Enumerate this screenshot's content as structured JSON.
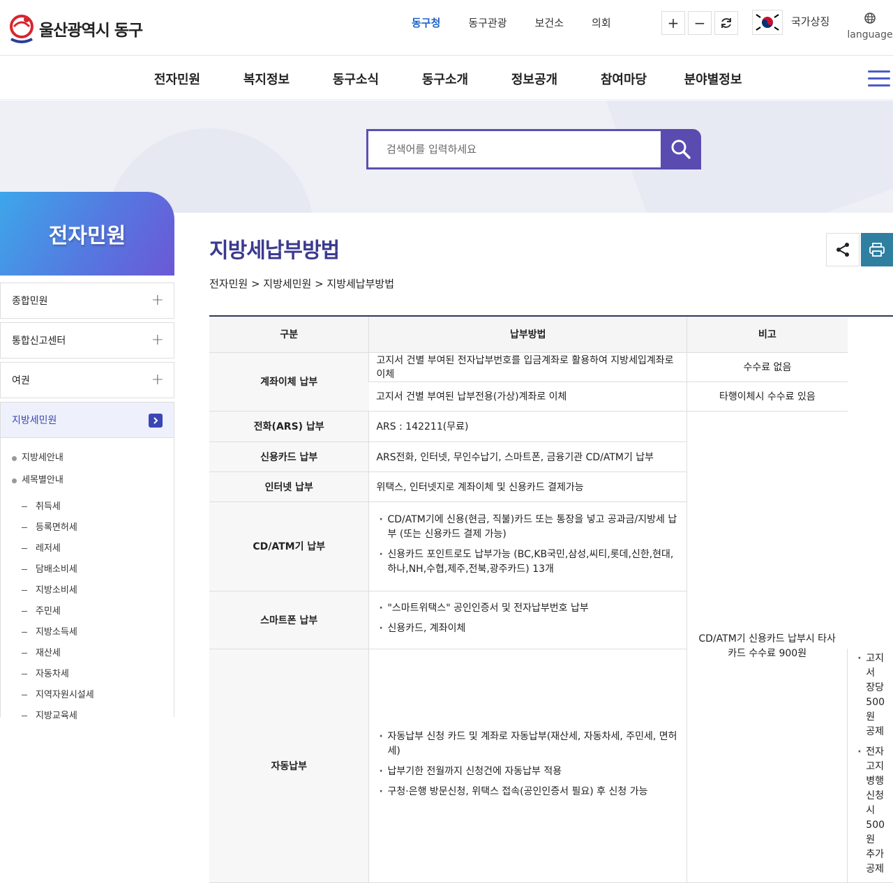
{
  "header": {
    "logo_text": "울산광역시 동구",
    "top_nav": [
      {
        "label": "동구청",
        "active": true
      },
      {
        "label": "동구관광",
        "active": false
      },
      {
        "label": "보건소",
        "active": false
      },
      {
        "label": "의회",
        "active": false
      }
    ],
    "national_symbol_label": "국가상징",
    "language_label": "language"
  },
  "main_nav": [
    "전자민원",
    "복지정보",
    "동구소식",
    "동구소개",
    "정보공개",
    "참여마당",
    "분야별정보"
  ],
  "search": {
    "placeholder": "검색어를 입력하세요"
  },
  "sidebar": {
    "title": "전자민원",
    "items": [
      "종합민원",
      "통합신고센터",
      "여권",
      "지방세민원"
    ],
    "subitems": [
      "지방세안내",
      "세목별안내"
    ],
    "subsubitems": [
      "취득세",
      "등록면허세",
      "레저세",
      "담배소비세",
      "지방소비세",
      "주민세",
      "지방소득세",
      "재산세",
      "자동차세",
      "지역자원시설세",
      "지방교육세"
    ]
  },
  "content": {
    "title": "지방세납부방법",
    "breadcrumb": "전자민원 > 지방세민원 > 지방세납부방법"
  },
  "table": {
    "headers": [
      "구분",
      "납부방법",
      "비고"
    ],
    "rows": {
      "account": {
        "category": "계좌이체 납부",
        "method1": "고지서 건별 부여된 전자납부번호를 입금계좌로 활용하여 지방세입계좌로 이체",
        "note1": "수수료 없음",
        "method2": "고지서 건별 부여된 납부전용(가상)계좌로 이체",
        "note2": "타행이체시 수수료 있음"
      },
      "ars": {
        "category": "전화(ARS) 납부",
        "method": "ARS : 142211(무료)"
      },
      "card": {
        "category": "신용카드 납부",
        "method": "ARS전화, 인터넷, 무인수납기, 스마트폰, 금융기관 CD/ATM기 납부"
      },
      "internet": {
        "category": "인터넷 납부",
        "method": "위택스, 인터넷지로 계좌이체 및 신용카드 결제가능"
      },
      "atm": {
        "category": "CD/ATM기 납부",
        "bullets": [
          "CD/ATM기에 신용(현금, 직불)카드 또는 통장을 넣고 공과금/지방세 납부 (또는 신용카드 결제 가능)",
          "신용카드 포인트로도 납부가능 (BC,KB국민,삼성,씨티,롯데,신한,현대, 하나,NH,수협,제주,전북,광주카드) 13개"
        ]
      },
      "shared_note": "CD/ATM기 신용카드 납부시 타사카드 수수료 900원",
      "smartphone": {
        "category": "스마트폰 납부",
        "bullets": [
          "\"스마트위택스\" 공인인증서 및 전자납부번호 납부",
          "신용카드, 계좌이체"
        ]
      },
      "auto": {
        "category": "자동납부",
        "bullets": [
          "자동납부 신청 카드 및 계좌로 자동납부(재산세, 자동차세, 주민세, 면허세)",
          "납부기한 전월까지 신청건에 자동납부 적용",
          "구청·은행 방문신청, 위택스 접속(공인인증서 필요) 후 신청 가능"
        ],
        "notes": [
          "고지서 장당 500원 공제",
          "전자고지 병행신청 시 500원 추가공제"
        ]
      }
    }
  },
  "colors": {
    "accent": "#3b3a8f",
    "search_button": "#5a4bb0",
    "active_nav": "#1e63c4",
    "print_button": "#2f7fa0"
  }
}
